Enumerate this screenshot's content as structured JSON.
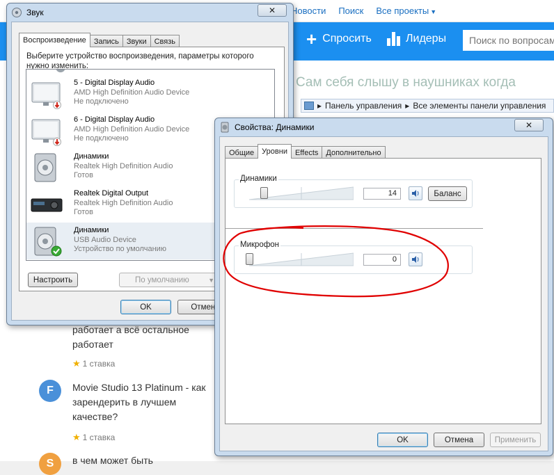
{
  "web": {
    "nav": [
      "Новости",
      "Поиск",
      "Все проекты"
    ],
    "ask_label": "Спросить",
    "leaders_label": "Лидеры",
    "search_placeholder": "Поиск по вопросам",
    "blurred_title": "Сам себя слышу в наушниках когда",
    "questions": [
      {
        "text": "работает а всё остальное работает",
        "meta": "1 ставка"
      },
      {
        "avatar": "F",
        "avatar_color": "#4a90d9",
        "text": "Movie Studio 13 Platinum - как зарендерить в лучшем качестве?",
        "meta": "1 ставка"
      },
      {
        "avatar": "S",
        "avatar_color": "#f0a040",
        "text": "в чем может быть"
      }
    ],
    "address_bar": [
      "Панель управления",
      "Все элементы панели управления"
    ]
  },
  "sound_window": {
    "title": "Звук",
    "tabs": [
      "Воспроизведение",
      "Запись",
      "Звуки",
      "Связь"
    ],
    "instructions": "Выберите устройство воспроизведения, параметры которого нужно изменить:",
    "devices": [
      {
        "name": "5 - Digital Display Audio",
        "driver": "AMD High Definition Audio Device",
        "status": "Не подключено",
        "icon": "monitor-icon"
      },
      {
        "name": "6 - Digital Display Audio",
        "driver": "AMD High Definition Audio Device",
        "status": "Не подключено",
        "icon": "monitor-icon"
      },
      {
        "name": "Динамики",
        "driver": "Realtek High Definition Audio",
        "status": "Готов",
        "icon": "speaker-icon"
      },
      {
        "name": "Realtek Digital Output",
        "driver": "Realtek High Definition Audio",
        "status": "Готов",
        "icon": "receiver-icon"
      },
      {
        "name": "Динамики",
        "driver": "USB Audio Device",
        "status": "Устройство по умолчанию",
        "icon": "speaker-icon"
      }
    ],
    "configure": "Настроить",
    "set_default": "По умолчанию",
    "ok": "OK",
    "cancel": "Отмена"
  },
  "props_window": {
    "title": "Свойства: Динамики",
    "tabs": [
      "Общие",
      "Уровни",
      "Effects",
      "Дополнительно"
    ],
    "speakers": {
      "label": "Динамики",
      "value": "14",
      "level": 0.14,
      "balance": "Баланс"
    },
    "mic": {
      "label": "Микрофон",
      "value": "0",
      "level": 0
    },
    "ok": "OK",
    "cancel": "Отмена",
    "apply": "Применить"
  },
  "colors": {
    "accent_blue": "#1b8ff0",
    "annotation_red": "#e00000",
    "default_check": "#3aaa35",
    "disconnect_red": "#d0281c"
  }
}
